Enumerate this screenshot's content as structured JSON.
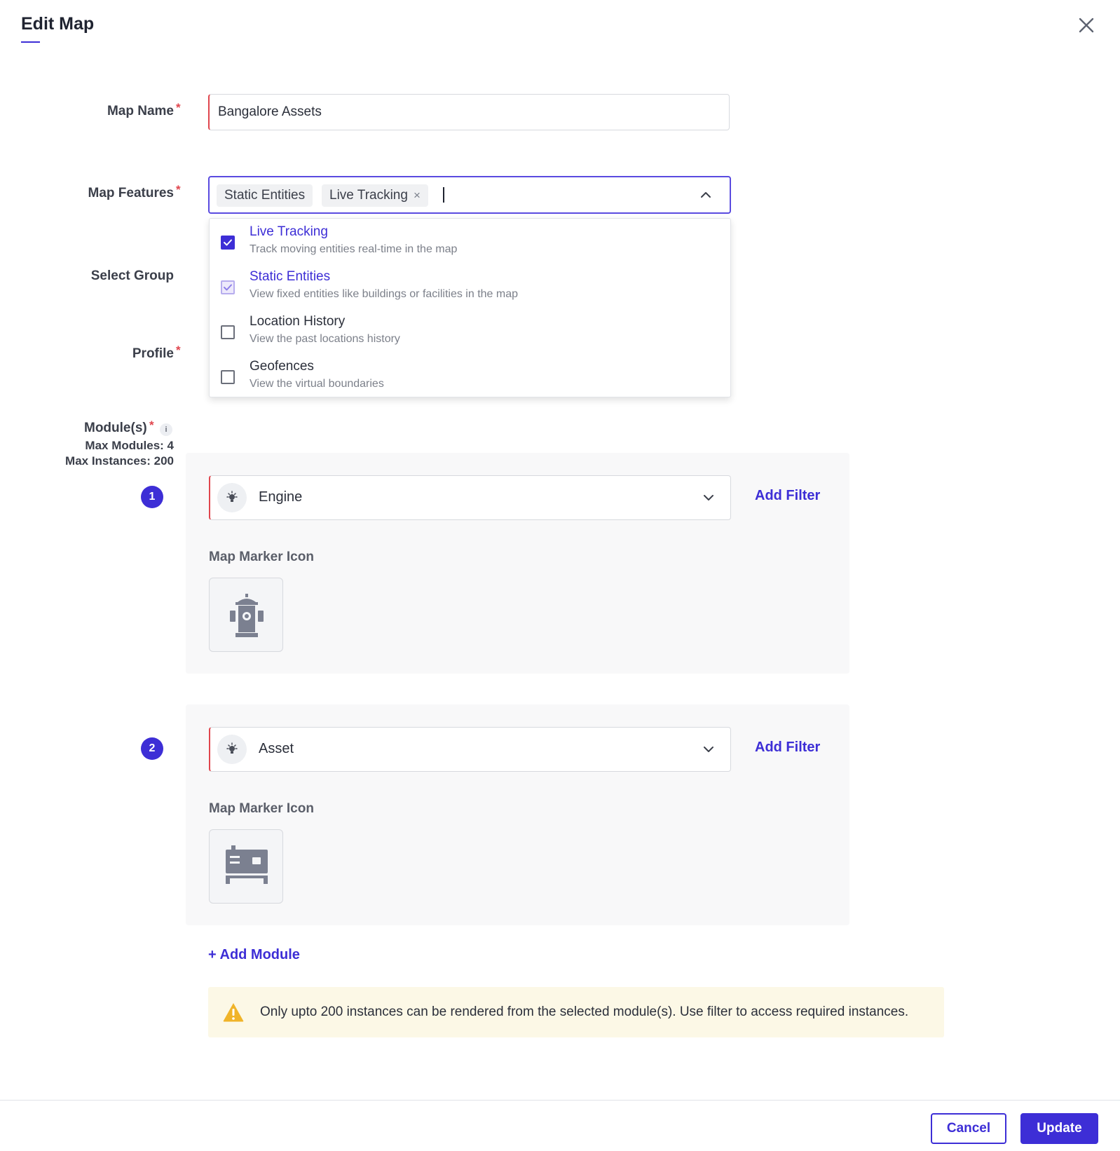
{
  "dialog": {
    "title": "Edit Map"
  },
  "form": {
    "map_name_label": "Map Name",
    "map_name_value": "Bangalore Assets",
    "map_features_label": "Map Features",
    "select_group_label": "Select Group",
    "profile_label": "Profile",
    "required_mark": "*",
    "selected_chips": [
      {
        "label": "Static Entities"
      },
      {
        "label": "Live Tracking",
        "removable": true,
        "remove_glyph": "×"
      }
    ]
  },
  "feature_options": [
    {
      "title": "Live Tracking",
      "description": "Track moving entities real-time in the map",
      "checked": true
    },
    {
      "title": "Static Entities",
      "description": "View fixed entities like buildings or facilities in the map",
      "checked": true
    },
    {
      "title": "Location History",
      "description": "View the past locations history",
      "checked": false
    },
    {
      "title": "Geofences",
      "description": "View the virtual boundaries",
      "checked": false
    }
  ],
  "modules": {
    "label": "Module(s)",
    "info_glyph": "i",
    "max_modules": "Max Modules: 4",
    "max_instances": "Max Instances: 200",
    "items": [
      {
        "number": "1",
        "name": "Engine",
        "add_filter": "Add Filter",
        "marker_label": "Map Marker Icon",
        "marker_icon": "fire-hydrant-icon"
      },
      {
        "number": "2",
        "name": "Asset",
        "add_filter": "Add Filter",
        "marker_label": "Map Marker Icon",
        "marker_icon": "generator-icon"
      }
    ],
    "add_module": "+ Add Module"
  },
  "warning": {
    "text": "Only upto 200 instances can be rendered from the selected module(s). Use filter to access required instances."
  },
  "footer": {
    "cancel": "Cancel",
    "update": "Update"
  },
  "colors": {
    "accent": "#3d2ed6",
    "required": "#e0454d",
    "warning_bg": "#fcf8e6",
    "warning_icon": "#f0b429"
  }
}
